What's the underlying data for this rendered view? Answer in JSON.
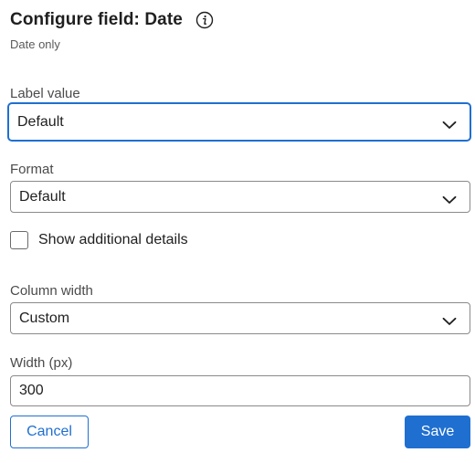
{
  "header": {
    "title": "Configure field: Date",
    "subtitle": "Date only",
    "info_icon": "info-icon"
  },
  "label_value": {
    "label": "Label value",
    "selected": "Default"
  },
  "format": {
    "label": "Format",
    "selected": "Default"
  },
  "additional_details": {
    "label": "Show additional details",
    "checked": false
  },
  "column_width": {
    "label": "Column width",
    "selected": "Custom"
  },
  "width_px": {
    "label": "Width (px)",
    "value": "300"
  },
  "actions": {
    "cancel_label": "Cancel",
    "save_label": "Save"
  },
  "colors": {
    "accent": "#1f6fd1",
    "text": "#1f1f1f",
    "muted": "#5a5a5a",
    "border": "#8a8a8a"
  }
}
